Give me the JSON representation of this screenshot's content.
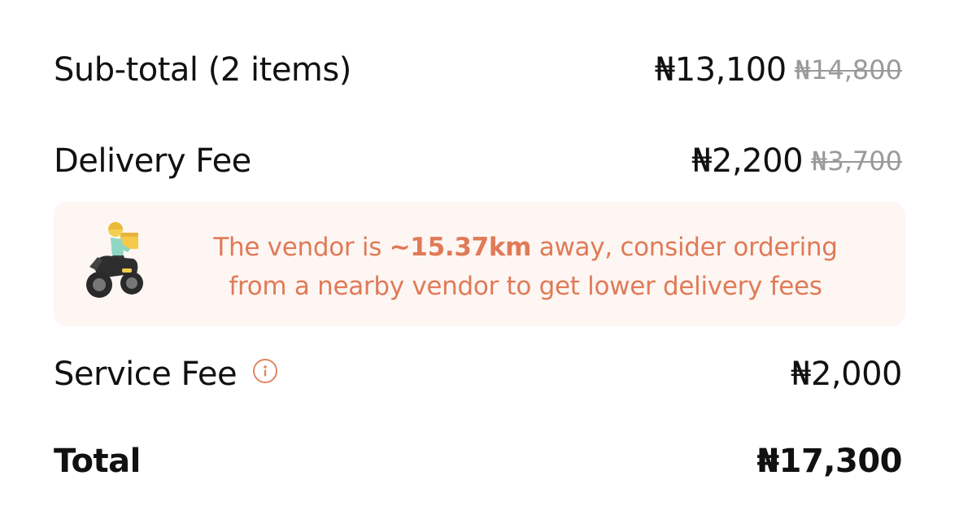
{
  "summary": {
    "subtotal": {
      "label": "Sub-total (2 items)",
      "price": "₦13,100",
      "old_price": "₦14,800"
    },
    "delivery": {
      "label": "Delivery Fee",
      "price": "₦2,200",
      "old_price": "₦3,700"
    },
    "notice": {
      "prefix": "The vendor is ",
      "distance": "~15.37km",
      "suffix_line1": " away, consider ordering",
      "line2": "from a nearby vendor to get lower delivery fees",
      "illustration": "delivery-rider-motorbike"
    },
    "service": {
      "label": "Service Fee",
      "price": "₦2,000",
      "icon": "info-icon"
    },
    "total": {
      "label": "Total",
      "price": "₦17,300"
    }
  },
  "colors": {
    "accent": "#e07a57",
    "notice_bg": "#fdf6f3",
    "strike": "#9a9a9a"
  }
}
